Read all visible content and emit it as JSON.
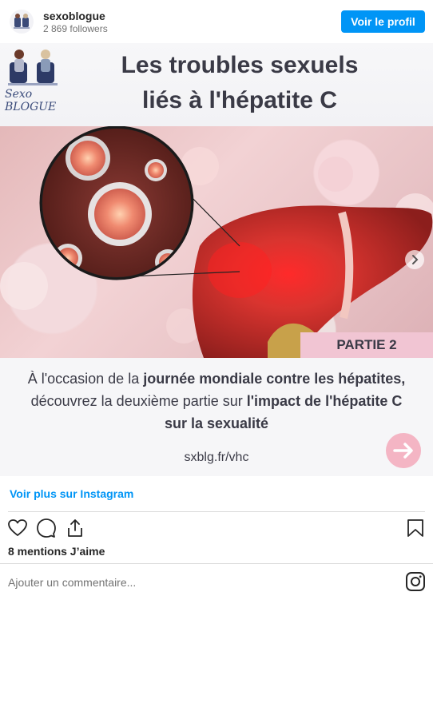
{
  "header": {
    "username": "sexoblogue",
    "followers": "2 869 followers",
    "profile_button": "Voir le profil"
  },
  "post": {
    "logo_text": "Sexo BLOGUE",
    "title_line1": "Les troubles sexuels",
    "title_line2": "liés à l'hépatite C",
    "partie": "PARTIE 2",
    "desc_part1": "À l'occasion de la ",
    "desc_bold1": "journée mondiale contre les hépatites,",
    "desc_part2": "découvrez la deuxième partie sur ",
    "desc_bold2": "l'impact de l'hépatite C",
    "desc_bold3": "sur la sexualité",
    "url": "sxblg.fr/vhc"
  },
  "footer": {
    "more_link": "Voir plus sur Instagram",
    "likes": "8 mentions J’aime",
    "comment_placeholder": "Ajouter un commentaire..."
  },
  "icons": {
    "like": "heart-icon",
    "comment": "comment-bubble-icon",
    "share": "share-icon",
    "save": "bookmark-icon",
    "instagram": "instagram-icon",
    "next": "chevron-right-icon",
    "arrow": "arrow-right-icon"
  },
  "colors": {
    "accent": "#0095f6",
    "partie_bg": "#f1c5d3",
    "arrow_bg": "#f4b5c4",
    "liver": "#c9302c"
  }
}
